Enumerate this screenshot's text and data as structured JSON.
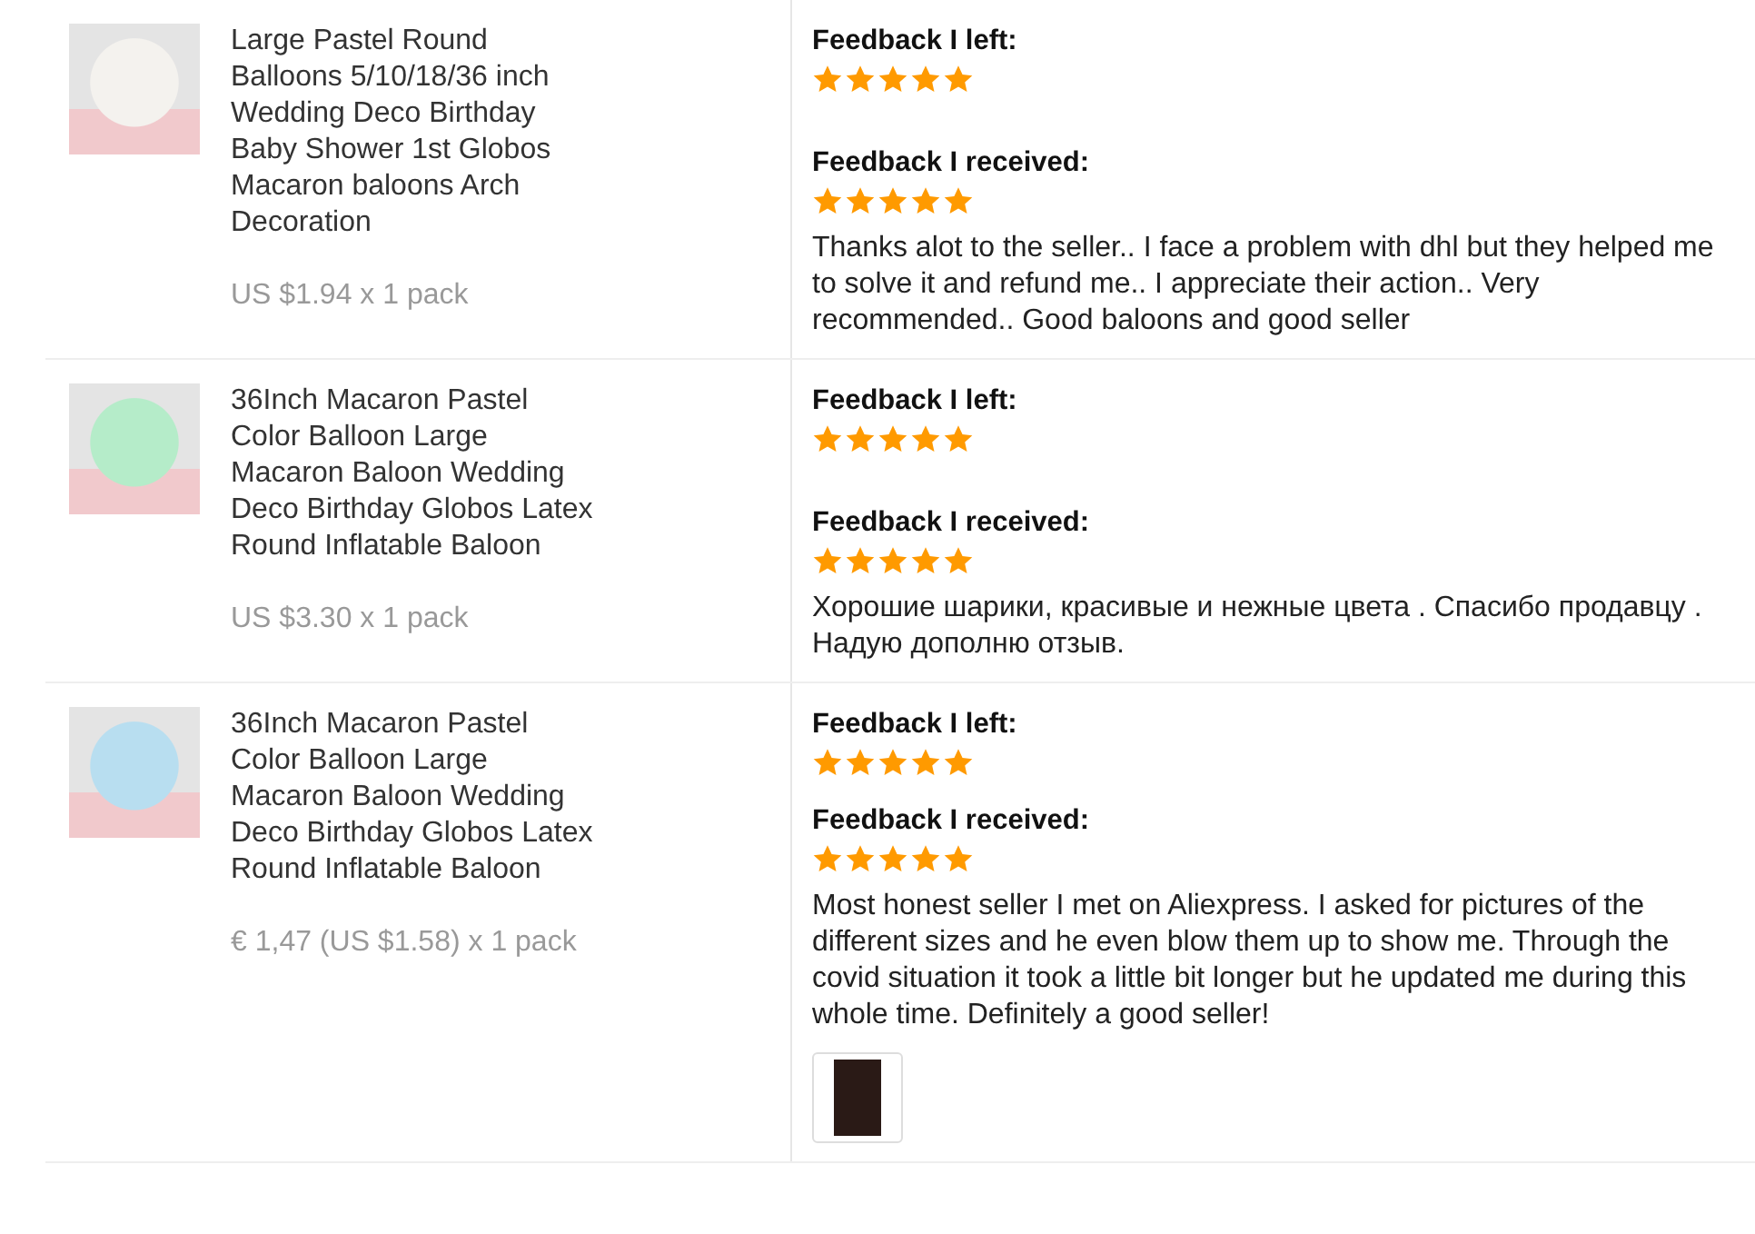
{
  "orders": [
    {
      "product": {
        "color": "#f4f2ee",
        "title": "Large Pastel Round Balloons 5/10/18/36 inch Wedding Deco Birthday Baby Shower 1st Globos Macaron baloons Arch Decoration",
        "price": "US $1.94 x 1 pack"
      },
      "feedback_left": {
        "label": "Feedback I left:",
        "stars": 5
      },
      "feedback_received": {
        "label": "Feedback I received:",
        "stars": 5,
        "comment": "Thanks alot to the seller.. I face a problem with dhl but they helped me to solve it and refund me.. I appreciate their action.. Very recommended.. Good baloons and good seller"
      }
    },
    {
      "product": {
        "color": "#b5ecc9",
        "title": "36Inch Macaron Pastel Color Balloon Large Macaron Baloon Wedding Deco Birthday Globos Latex Round Inflatable Baloon",
        "price": "US $3.30 x 1 pack"
      },
      "feedback_left": {
        "label": "Feedback I left:",
        "stars": 5
      },
      "feedback_received": {
        "label": "Feedback I received:",
        "stars": 5,
        "comment": "Хорошие шарики, красивые и нежные цвета . Спасибо продавцу . Надую дополню отзыв."
      }
    },
    {
      "product": {
        "color": "#b8def0",
        "title": "36Inch Macaron Pastel Color Balloon Large Macaron Baloon Wedding Deco Birthday Globos Latex Round Inflatable Baloon",
        "price": "€ 1,47 (US $1.58) x 1 pack"
      },
      "feedback_left": {
        "label": "Feedback I left:",
        "stars": 5
      },
      "feedback_received": {
        "label": "Feedback I received:",
        "stars": 5,
        "comment": "Most honest seller I met on Aliexpress. I asked for pictures of the different sizes and he even blow them up to show me. Through the covid situation it took a little bit longer but he updated me during this whole time. Definitely a good seller!",
        "attachments": [
          {
            "kind": "photo"
          }
        ]
      }
    }
  ]
}
